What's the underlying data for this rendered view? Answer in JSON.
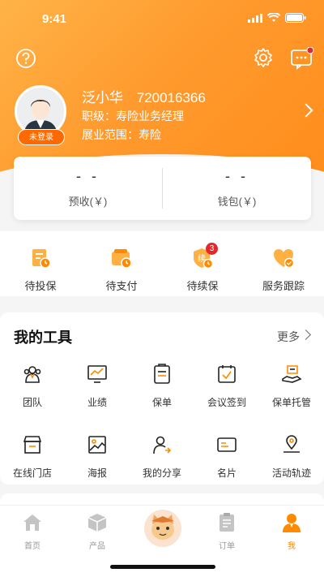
{
  "status": {
    "time": "9:41"
  },
  "profile": {
    "name": "泛小华",
    "id": "720016366",
    "rank_label": "职级：寿险业务经理",
    "scope_label": "展业范围：寿险",
    "login_badge": "未登录"
  },
  "balance": {
    "items": [
      {
        "value": "- -",
        "label": "预收(￥)"
      },
      {
        "value": "- -",
        "label": "钱包(￥)"
      }
    ]
  },
  "orders": {
    "items": [
      {
        "label": "待投保",
        "icon": "policy-pending-icon"
      },
      {
        "label": "待支付",
        "icon": "wallet-pending-icon"
      },
      {
        "label": "待续保",
        "icon": "renew-shield-icon",
        "badge": "3"
      },
      {
        "label": "服务跟踪",
        "icon": "service-track-icon"
      }
    ]
  },
  "tools": {
    "title": "我的工具",
    "more": "更多",
    "row1": [
      {
        "label": "团队",
        "icon": "team-icon"
      },
      {
        "label": "业绩",
        "icon": "performance-icon"
      },
      {
        "label": "保单",
        "icon": "policy-icon"
      },
      {
        "label": "会议签到",
        "icon": "meeting-checkin-icon"
      },
      {
        "label": "保单托管",
        "icon": "policy-custody-icon"
      }
    ],
    "row2": [
      {
        "label": "在线门店",
        "icon": "online-store-icon"
      },
      {
        "label": "海报",
        "icon": "poster-icon"
      },
      {
        "label": "我的分享",
        "icon": "share-icon"
      },
      {
        "label": "名片",
        "icon": "business-card-icon"
      },
      {
        "label": "活动轨迹",
        "icon": "activity-track-icon"
      }
    ]
  },
  "tabbar": {
    "items": [
      {
        "label": "首页",
        "icon": "home-icon"
      },
      {
        "label": "产品",
        "icon": "product-icon"
      },
      {
        "label": "",
        "icon": "mascot-avatar-icon"
      },
      {
        "label": "订单",
        "icon": "order-icon"
      },
      {
        "label": "我",
        "icon": "me-icon"
      }
    ]
  },
  "colors": {
    "accent": "#ff8a00",
    "badge": "#e4262d"
  }
}
